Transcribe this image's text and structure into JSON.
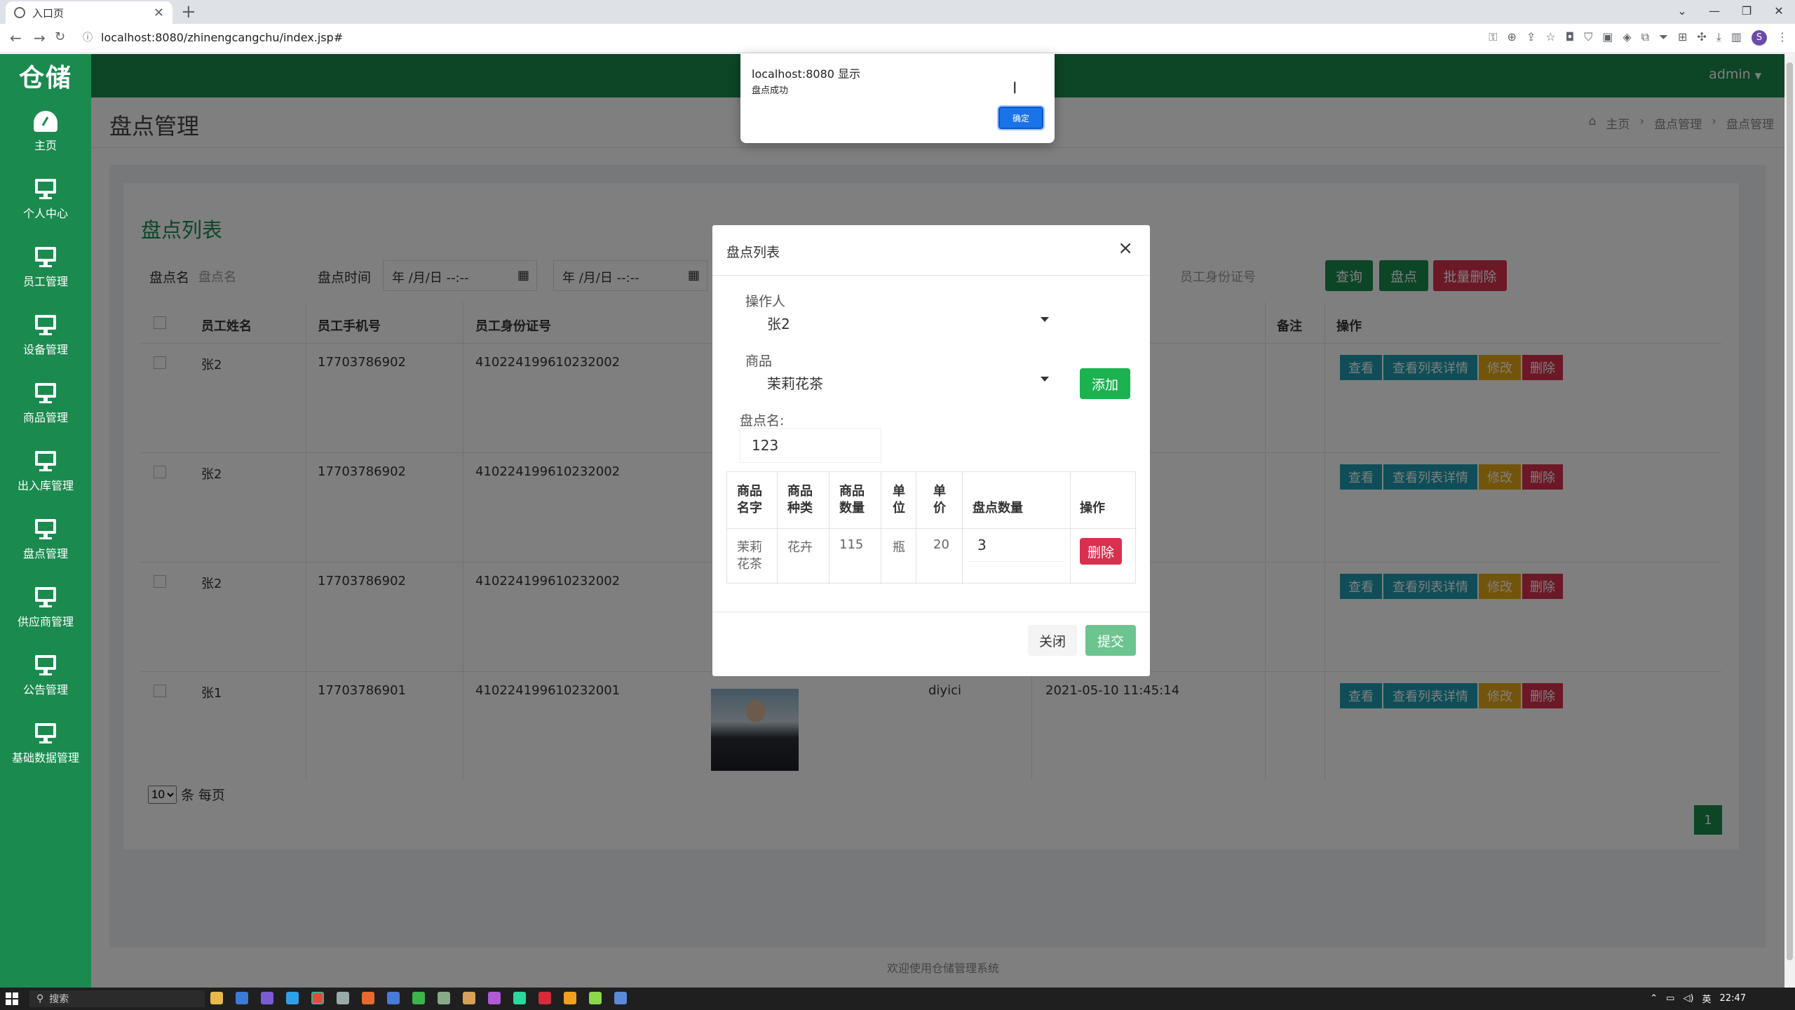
{
  "browser": {
    "tab_title": "入口页",
    "url": "localhost:8080/zhinengcangchu/index.jsp#"
  },
  "app": {
    "logo": "仓储",
    "user": "admin",
    "page_title": "盘点管理",
    "breadcrumb": [
      "主页",
      "盘点管理",
      "盘点管理"
    ],
    "footer": "欢迎使用仓储管理系统"
  },
  "sidebar": {
    "items": [
      {
        "label": "主页",
        "icon": "dashboard-icon"
      },
      {
        "label": "个人中心",
        "icon": "monitor-icon"
      },
      {
        "label": "员工管理",
        "icon": "monitor-icon"
      },
      {
        "label": "设备管理",
        "icon": "monitor-icon"
      },
      {
        "label": "商品管理",
        "icon": "monitor-icon"
      },
      {
        "label": "出入库管理",
        "icon": "monitor-icon"
      },
      {
        "label": "盘点管理",
        "icon": "monitor-icon"
      },
      {
        "label": "供应商管理",
        "icon": "monitor-icon"
      },
      {
        "label": "公告管理",
        "icon": "monitor-icon"
      },
      {
        "label": "基础数据管理",
        "icon": "monitor-icon"
      }
    ]
  },
  "list": {
    "title": "盘点列表",
    "filters": {
      "name_label": "盘点名",
      "name_placeholder": "盘点名",
      "time_label": "盘点时间",
      "date_from": "年 /月/日 --:--",
      "date_to": "年 /月/日 --:--",
      "idcard_placeholder": "员工身份证号"
    },
    "buttons": {
      "search": "查询",
      "inventory": "盘点",
      "batch_delete": "批量删除"
    },
    "columns": [
      "员工姓名",
      "员工手机号",
      "员工身份证号",
      "备注",
      "操作"
    ],
    "rows": [
      {
        "name": "张2",
        "phone": "17703786902",
        "idcard": "410224199610232002",
        "extra": "",
        "date": ""
      },
      {
        "name": "张2",
        "phone": "17703786902",
        "idcard": "410224199610232002",
        "extra": "",
        "date": ""
      },
      {
        "name": "张2",
        "phone": "17703786902",
        "idcard": "410224199610232002",
        "extra": "",
        "date": ""
      },
      {
        "name": "张1",
        "phone": "17703786901",
        "idcard": "410224199610232001",
        "extra": "diyici",
        "date": "2021-05-10 11:45:14"
      }
    ],
    "row_actions": {
      "view": "查看",
      "view_detail": "查看列表详情",
      "edit": "修改",
      "delete": "删除"
    },
    "page_size": "10",
    "page_size_suffix": "条 每页",
    "current_page": "1"
  },
  "modal": {
    "title": "盘点列表",
    "operator_label": "操作人",
    "operator_value": "张2",
    "goods_label": "商品",
    "goods_value": "茉莉花茶",
    "add_button": "添加",
    "name_label": "盘点名:",
    "name_value": "123",
    "table_headers": [
      "商品名字",
      "商品种类",
      "商品数量",
      "单位",
      "单价",
      "盘点数量",
      "操作"
    ],
    "table_row": {
      "name": "茉莉花茶",
      "kind": "花卉",
      "qty": "115",
      "unit": "瓶",
      "price": "20",
      "count": "3",
      "action": "删除"
    },
    "close_button": "关闭",
    "submit_button": "提交"
  },
  "alert": {
    "title": "localhost:8080 显示",
    "message": "盘点成功",
    "ok": "确定"
  },
  "taskbar": {
    "search": "搜索",
    "ime": "英",
    "time": "22:47"
  }
}
